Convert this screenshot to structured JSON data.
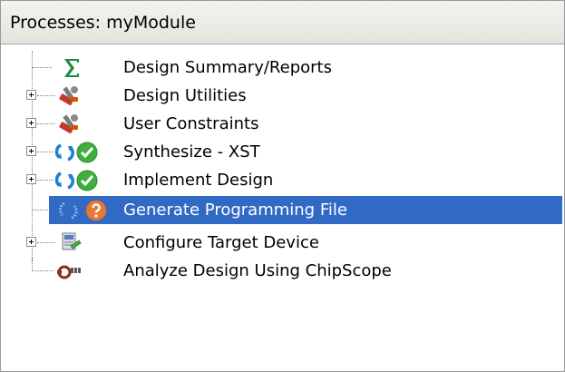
{
  "panel": {
    "title": "Processes: myModule"
  },
  "processes": [
    {
      "label": "Design Summary/Reports",
      "icon": "sigma-icon",
      "expandable": false
    },
    {
      "label": "Design Utilities",
      "icon": "tools-icon",
      "expandable": true
    },
    {
      "label": "User Constraints",
      "icon": "tools-icon",
      "expandable": true
    },
    {
      "label": "Synthesize - XST",
      "icon": "run-ok-icon",
      "expandable": true
    },
    {
      "label": "Implement Design",
      "icon": "run-ok-icon",
      "expandable": true
    },
    {
      "label": "Generate Programming File",
      "icon": "run-unknown-icon",
      "expandable": false,
      "selected": true
    },
    {
      "label": "Configure Target Device",
      "icon": "device-icon",
      "expandable": true
    },
    {
      "label": "Analyze Design Using ChipScope",
      "icon": "chipscope-icon",
      "expandable": false
    }
  ],
  "colors": {
    "selection": "#316ac5",
    "ok_green": "#3fae3f",
    "unknown_orange": "#e07b3a",
    "refresh_blue": "#1c7fd0"
  }
}
